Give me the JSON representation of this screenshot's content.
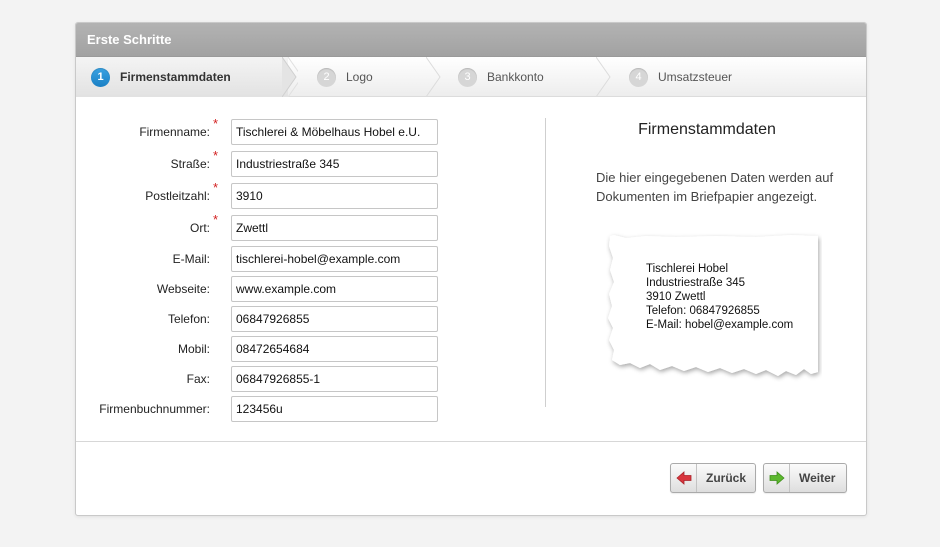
{
  "dialog": {
    "title": "Erste Schritte"
  },
  "steps": [
    {
      "num": "1",
      "label": "Firmenstammdaten",
      "active": true
    },
    {
      "num": "2",
      "label": "Logo",
      "active": false
    },
    {
      "num": "3",
      "label": "Bankkonto",
      "active": false
    },
    {
      "num": "4",
      "label": "Umsatzsteuer",
      "active": false
    }
  ],
  "form": {
    "fields": [
      {
        "label": "Firmenname:",
        "required": true,
        "value": "Tischlerei & Möbelhaus Hobel e.U."
      },
      {
        "label": "Straße:",
        "required": true,
        "value": "Industriestraße 345"
      },
      {
        "label": "Postleitzahl:",
        "required": true,
        "value": "3910"
      },
      {
        "label": "Ort:",
        "required": true,
        "value": "Zwettl"
      },
      {
        "label": "E-Mail:",
        "required": false,
        "value": "tischlerei-hobel@example.com"
      },
      {
        "label": "Webseite:",
        "required": false,
        "value": "www.example.com"
      },
      {
        "label": "Telefon:",
        "required": false,
        "value": "06847926855"
      },
      {
        "label": "Mobil:",
        "required": false,
        "value": "08472654684"
      },
      {
        "label": "Fax:",
        "required": false,
        "value": "06847926855-1"
      },
      {
        "label": "Firmenbuchnummer:",
        "required": false,
        "value": "123456u"
      }
    ],
    "required_marker": "*"
  },
  "info": {
    "title": "Firmenstammdaten",
    "text": "Die hier eingegebenen Daten werden auf Dokumenten im Briefpapier angezeigt.",
    "preview_lines": [
      "Tischlerei Hobel",
      "Industriestraße 345",
      "3910 Zwettl",
      "Telefon: 06847926855",
      "E-Mail: hobel@example.com"
    ]
  },
  "buttons": {
    "back": {
      "label": "Zurück",
      "icon": "arrow-left-icon",
      "color": "#d9363e"
    },
    "next": {
      "label": "Weiter",
      "icon": "arrow-right-icon",
      "color": "#5cb82e"
    }
  },
  "colors": {
    "titlebar": "#a9a9a9",
    "active_step": "#1a7fc4",
    "required": "#d32020"
  }
}
